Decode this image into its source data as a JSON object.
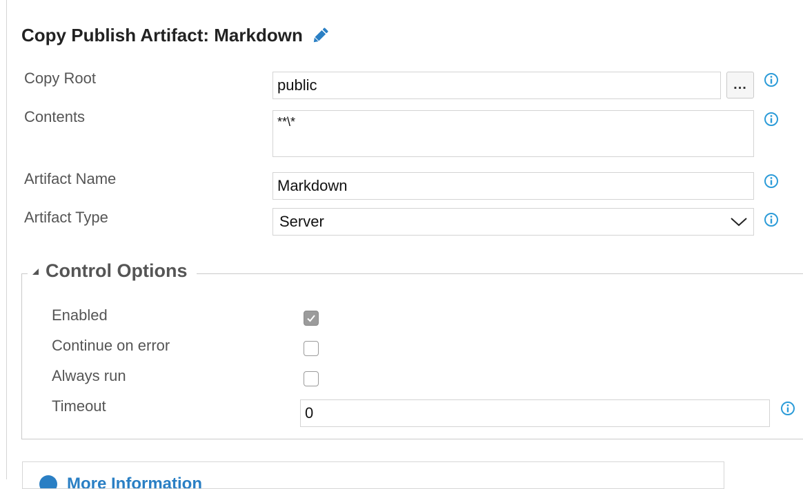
{
  "task": {
    "title": "Copy Publish Artifact: Markdown"
  },
  "fields": {
    "copy_root": {
      "label": "Copy Root",
      "value": "public",
      "browse_label": "..."
    },
    "contents": {
      "label": "Contents",
      "value": "**\\*"
    },
    "artifact_name": {
      "label": "Artifact Name",
      "value": "Markdown"
    },
    "artifact_type": {
      "label": "Artifact Type",
      "selected": "Server"
    }
  },
  "control_options": {
    "heading": "Control Options",
    "enabled": {
      "label": "Enabled",
      "checked": true
    },
    "continue_on_error": {
      "label": "Continue on error",
      "checked": false
    },
    "always_run": {
      "label": "Always run",
      "checked": false
    },
    "timeout": {
      "label": "Timeout",
      "value": "0"
    }
  },
  "more_info": {
    "label": "More Information"
  },
  "colors": {
    "info_icon": "#2b9bd8",
    "pencil": "#2a7fc4",
    "checkbox_checked": "#9b9b9b",
    "link": "#2a7fc4"
  },
  "icons": [
    "pencil-icon",
    "info-icon",
    "chevron-down-icon",
    "collapse-triangle-icon",
    "checkmark-icon"
  ]
}
